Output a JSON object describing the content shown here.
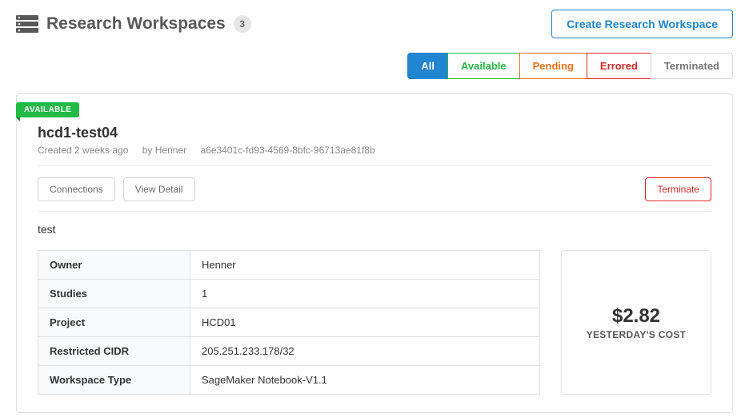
{
  "header": {
    "title": "Research Workspaces",
    "count": "3",
    "create_label": "Create Research Workspace"
  },
  "tabs": {
    "all": "All",
    "available": "Available",
    "pending": "Pending",
    "errored": "Errored",
    "terminated": "Terminated"
  },
  "workspace": {
    "status": "AVAILABLE",
    "name": "hcd1-test04",
    "created": "Created 2 weeks ago",
    "by": "by Henner",
    "uuid": "a6e3401c-fd93-4569-8bfc-96713ae81f8b",
    "description": "test",
    "actions": {
      "connections": "Connections",
      "view_detail": "View Detail",
      "terminate": "Terminate"
    },
    "details": {
      "owner_label": "Owner",
      "owner": "Henner",
      "studies_label": "Studies",
      "studies": "1",
      "project_label": "Project",
      "project": "HCD01",
      "cidr_label": "Restricted CIDR",
      "cidr": "205.251.233.178/32",
      "type_label": "Workspace Type",
      "type": "SageMaker Notebook-V1.1"
    },
    "cost": {
      "amount": "$2.82",
      "label": "YESTERDAY'S COST"
    }
  }
}
